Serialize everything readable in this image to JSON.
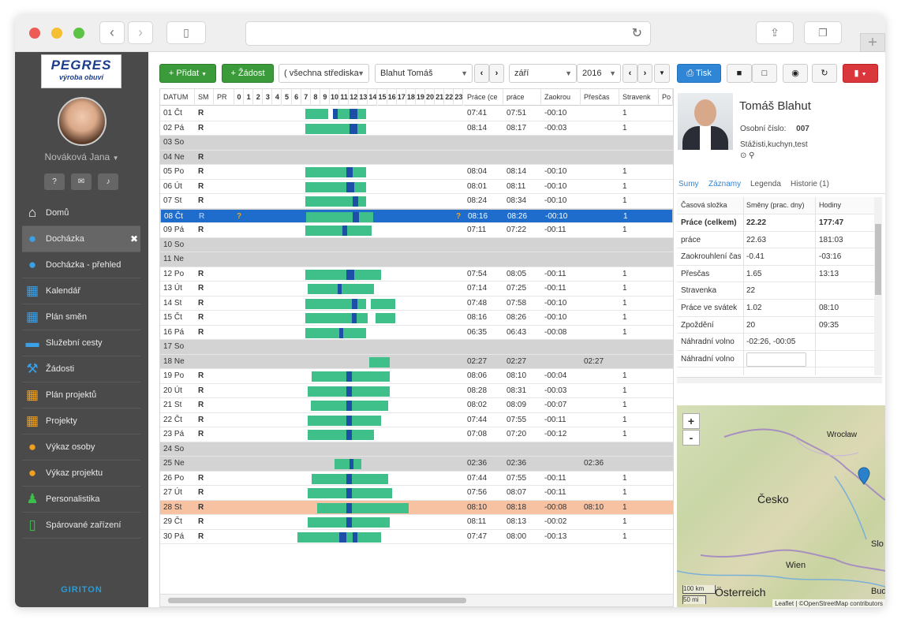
{
  "user": {
    "name": "Nováková Jana"
  },
  "nav": [
    {
      "label": "Domů",
      "icon": "home-icon",
      "glyph": "⌂"
    },
    {
      "label": "Docházka",
      "icon": "user-icon",
      "glyph": "●",
      "active": true
    },
    {
      "label": "Docházka - přehled",
      "icon": "users-icon",
      "glyph": "●"
    },
    {
      "label": "Kalendář",
      "icon": "calendar-icon",
      "glyph": "▦"
    },
    {
      "label": "Plán směn",
      "icon": "calendar-grid-icon",
      "glyph": "▦"
    },
    {
      "label": "Služební cesty",
      "icon": "car-icon",
      "glyph": "▬"
    },
    {
      "label": "Žádosti",
      "icon": "gavel-icon",
      "glyph": "⚒"
    },
    {
      "label": "Plán projektů",
      "icon": "calendar-grid-icon",
      "glyph": "▦"
    },
    {
      "label": "Projekty",
      "icon": "calendar-icon",
      "glyph": "▦"
    },
    {
      "label": "Výkaz osoby",
      "icon": "user-icon",
      "glyph": "●"
    },
    {
      "label": "Výkaz projektu",
      "icon": "users-icon",
      "glyph": "●"
    },
    {
      "label": "Personalistika",
      "icon": "person-icon",
      "glyph": "♟"
    },
    {
      "label": "Spárované zařízení",
      "icon": "phone-icon",
      "glyph": "▯"
    }
  ],
  "nav_colors": [
    "#ffffff",
    "#3aa0e8",
    "#3aa0e8",
    "#3aa0e8",
    "#3aa0e8",
    "#3aa0e8",
    "#3aa0e8",
    "#f0a020",
    "#f0a020",
    "#f0a020",
    "#f0a020",
    "#3cbf4a",
    "#3cbf4a"
  ],
  "logo": {
    "line1": "PEGRES",
    "line2": "výroba obuví"
  },
  "footer_logo": "GIRITON",
  "toolbar": {
    "add": "+ Přidat",
    "request": "+ Žádost",
    "center": "( všechna střediska",
    "person": "Blahut Tomáš",
    "month": "září",
    "year": "2016",
    "print": "Tisk"
  },
  "columns": {
    "date": "DATUM",
    "sm": "SM",
    "pr": "PR",
    "hours": [
      "0",
      "1",
      "2",
      "3",
      "4",
      "5",
      "6",
      "7",
      "8",
      "9",
      "10",
      "11",
      "12",
      "13",
      "14",
      "15",
      "16",
      "17",
      "18",
      "19",
      "20",
      "21",
      "22",
      "23"
    ],
    "work": "Práce (ce",
    "prace": "práce",
    "zaokr": "Zaokrou",
    "prescas": "Přesčas",
    "stravenka": "Stravenk",
    "po": "Po"
  },
  "rows": [
    {
      "d": "01 Čt",
      "r": "R",
      "w": "07:41",
      "p": "07:51",
      "z": "-00:10",
      "s": "1",
      "bars": [
        [
          7.4,
          9.8
        ],
        [
          10.3,
          13.8
        ]
      ],
      "mk": [
        [
          10.3,
          10.8
        ],
        [
          12.1,
          12.9
        ]
      ]
    },
    {
      "d": "02 Pá",
      "r": "R",
      "w": "08:14",
      "p": "08:17",
      "z": "-00:03",
      "s": "1",
      "bars": [
        [
          7.4,
          13.8
        ]
      ],
      "mk": [
        [
          12.1,
          12.9
        ]
      ]
    },
    {
      "d": "03 So",
      "wk": true
    },
    {
      "d": "04 Ne",
      "r": "R",
      "wk": true
    },
    {
      "d": "05 Po",
      "r": "R",
      "w": "08:04",
      "p": "08:14",
      "z": "-00:10",
      "s": "1",
      "bars": [
        [
          7.4,
          13.8
        ]
      ],
      "mk": [
        [
          11.7,
          12.4
        ]
      ]
    },
    {
      "d": "06 Út",
      "r": "R",
      "w": "08:01",
      "p": "08:11",
      "z": "-00:10",
      "s": "1",
      "bars": [
        [
          7.4,
          13.8
        ]
      ],
      "mk": [
        [
          11.7,
          12.6
        ]
      ]
    },
    {
      "d": "07 St",
      "r": "R",
      "w": "08:24",
      "p": "08:34",
      "z": "-00:10",
      "s": "1",
      "bars": [
        [
          7.4,
          13.8
        ]
      ],
      "mk": [
        [
          12.4,
          13.0
        ]
      ]
    },
    {
      "d": "08 Čt",
      "r": "R",
      "sel": true,
      "q": true,
      "w": "08:16",
      "p": "08:26",
      "z": "-00:10",
      "s": "1",
      "bars": [
        [
          7.4,
          14.5
        ]
      ],
      "mk": [
        [
          12.3,
          13.0
        ]
      ]
    },
    {
      "d": "09 Pá",
      "r": "R",
      "w": "07:11",
      "p": "07:22",
      "z": "-00:11",
      "s": "1",
      "bars": [
        [
          7.4,
          14.4
        ]
      ],
      "mk": [
        [
          11.3,
          11.8
        ]
      ]
    },
    {
      "d": "10 So",
      "wk": true
    },
    {
      "d": "11 Ne",
      "wk": true
    },
    {
      "d": "12 Po",
      "r": "R",
      "w": "07:54",
      "p": "08:05",
      "z": "-00:11",
      "s": "1",
      "bars": [
        [
          7.4,
          15.4
        ]
      ],
      "mk": [
        [
          11.7,
          12.6
        ]
      ]
    },
    {
      "d": "13 Út",
      "r": "R",
      "w": "07:14",
      "p": "07:25",
      "z": "-00:11",
      "s": "1",
      "bars": [
        [
          7.7,
          14.6
        ]
      ],
      "mk": [
        [
          10.8,
          11.2
        ]
      ]
    },
    {
      "d": "14 St",
      "r": "R",
      "w": "07:48",
      "p": "07:58",
      "z": "-00:10",
      "s": "1",
      "bars": [
        [
          7.4,
          13.8
        ],
        [
          14.3,
          16.9
        ]
      ],
      "mk": [
        [
          12.3,
          12.9
        ]
      ]
    },
    {
      "d": "15 Čt",
      "r": "R",
      "w": "08:16",
      "p": "08:26",
      "z": "-00:10",
      "s": "1",
      "bars": [
        [
          7.4,
          14.0
        ],
        [
          14.8,
          16.9
        ]
      ],
      "mk": [
        [
          12.3,
          12.8
        ]
      ]
    },
    {
      "d": "16 Pá",
      "r": "R",
      "w": "06:35",
      "p": "06:43",
      "z": "-00:08",
      "s": "1",
      "bars": [
        [
          7.4,
          13.8
        ]
      ],
      "mk": [
        [
          11.0,
          11.4
        ]
      ]
    },
    {
      "d": "17 So",
      "wk": true
    },
    {
      "d": "18 Ne",
      "wk": true,
      "w": "02:27",
      "p": "02:27",
      "ps": "02:27",
      "bars": [
        [
          14.1,
          16.3
        ]
      ]
    },
    {
      "d": "19 Po",
      "r": "R",
      "w": "08:06",
      "p": "08:10",
      "z": "-00:04",
      "s": "1",
      "bars": [
        [
          8.1,
          16.3
        ]
      ],
      "mk": [
        [
          11.7,
          12.3
        ]
      ]
    },
    {
      "d": "20 Út",
      "r": "R",
      "w": "08:28",
      "p": "08:31",
      "z": "-00:03",
      "s": "1",
      "bars": [
        [
          7.7,
          16.3
        ]
      ],
      "mk": [
        [
          11.7,
          12.3
        ]
      ]
    },
    {
      "d": "21 St",
      "r": "R",
      "w": "08:02",
      "p": "08:09",
      "z": "-00:07",
      "s": "1",
      "bars": [
        [
          8.0,
          16.1
        ]
      ],
      "mk": [
        [
          11.7,
          12.3
        ]
      ]
    },
    {
      "d": "22 Čt",
      "r": "R",
      "w": "07:44",
      "p": "07:55",
      "z": "-00:11",
      "s": "1",
      "bars": [
        [
          7.7,
          15.4
        ]
      ],
      "mk": [
        [
          11.7,
          12.3
        ]
      ]
    },
    {
      "d": "23 Pá",
      "r": "R",
      "w": "07:08",
      "p": "07:20",
      "z": "-00:12",
      "s": "1",
      "bars": [
        [
          7.7,
          14.6
        ]
      ],
      "mk": [
        [
          11.7,
          12.3
        ]
      ]
    },
    {
      "d": "24 So",
      "wk": true
    },
    {
      "d": "25 Ne",
      "wk": true,
      "w": "02:36",
      "p": "02:36",
      "ps": "02:36",
      "bars": [
        [
          10.5,
          13.3
        ]
      ],
      "mk": [
        [
          12.1,
          12.5
        ]
      ]
    },
    {
      "d": "26 Po",
      "r": "R",
      "w": "07:44",
      "p": "07:55",
      "z": "-00:11",
      "s": "1",
      "bars": [
        [
          8.1,
          16.1
        ]
      ],
      "mk": [
        [
          11.7,
          12.3
        ]
      ]
    },
    {
      "d": "27 Út",
      "r": "R",
      "w": "07:56",
      "p": "08:07",
      "z": "-00:11",
      "s": "1",
      "bars": [
        [
          7.7,
          16.5
        ]
      ],
      "mk": [
        [
          11.7,
          12.3
        ]
      ]
    },
    {
      "d": "28 St",
      "r": "R",
      "hl": true,
      "w": "08:10",
      "p": "08:18",
      "z": "-00:08",
      "ps": "08:10",
      "s": "1",
      "bars": [
        [
          8.7,
          18.3
        ]
      ],
      "mk": [
        [
          11.7,
          12.3
        ]
      ]
    },
    {
      "d": "29 Čt",
      "r": "R",
      "w": "08:11",
      "p": "08:13",
      "z": "-00:02",
      "s": "1",
      "bars": [
        [
          7.7,
          16.3
        ]
      ],
      "mk": [
        [
          11.7,
          12.3
        ]
      ]
    },
    {
      "d": "30 Pá",
      "r": "R",
      "w": "07:47",
      "p": "08:00",
      "z": "-00:13",
      "s": "1",
      "bars": [
        [
          6.6,
          15.4
        ]
      ],
      "mk": [
        [
          11.0,
          11.7
        ],
        [
          12.4,
          12.9
        ]
      ]
    }
  ],
  "employee": {
    "name": "Tomáš Blahut",
    "id_label": "Osobní číslo:",
    "id": "007",
    "tags": "Stážisti,kuchyn,test"
  },
  "tabs": [
    "Sumy",
    "Záznamy",
    "Legenda",
    "Historie (1)"
  ],
  "sum_header": [
    "Časová složka",
    "Směny (prac. dny)",
    "Hodiny"
  ],
  "sums": [
    [
      "Práce (celkem)",
      "22.22",
      "177:47"
    ],
    [
      "práce",
      "22.63",
      "181:03"
    ],
    [
      "Zaokrouhlení čas",
      "-0.41",
      "-03:16"
    ],
    [
      "Přesčas",
      "1.65",
      "13:13"
    ],
    [
      "Stravenka",
      "22",
      ""
    ],
    [
      "Práce ve svátek",
      "1.02",
      "08:10"
    ],
    [
      "Zpoždění",
      "20",
      "09:35"
    ],
    [
      "Náhradní volno",
      "-02:26, -00:05",
      ""
    ],
    [
      "Náhradní volno",
      "",
      ""
    ]
  ],
  "map": {
    "zoom_in": "+",
    "zoom_out": "-",
    "cities": [
      "Wrocław",
      "Česko",
      "Wien",
      "Österreich",
      "Buda",
      "Slo"
    ],
    "scale1": "100 km",
    "scale2": "50 mi",
    "attribution": "Leaflet | ©OpenStreetMap contributors"
  }
}
